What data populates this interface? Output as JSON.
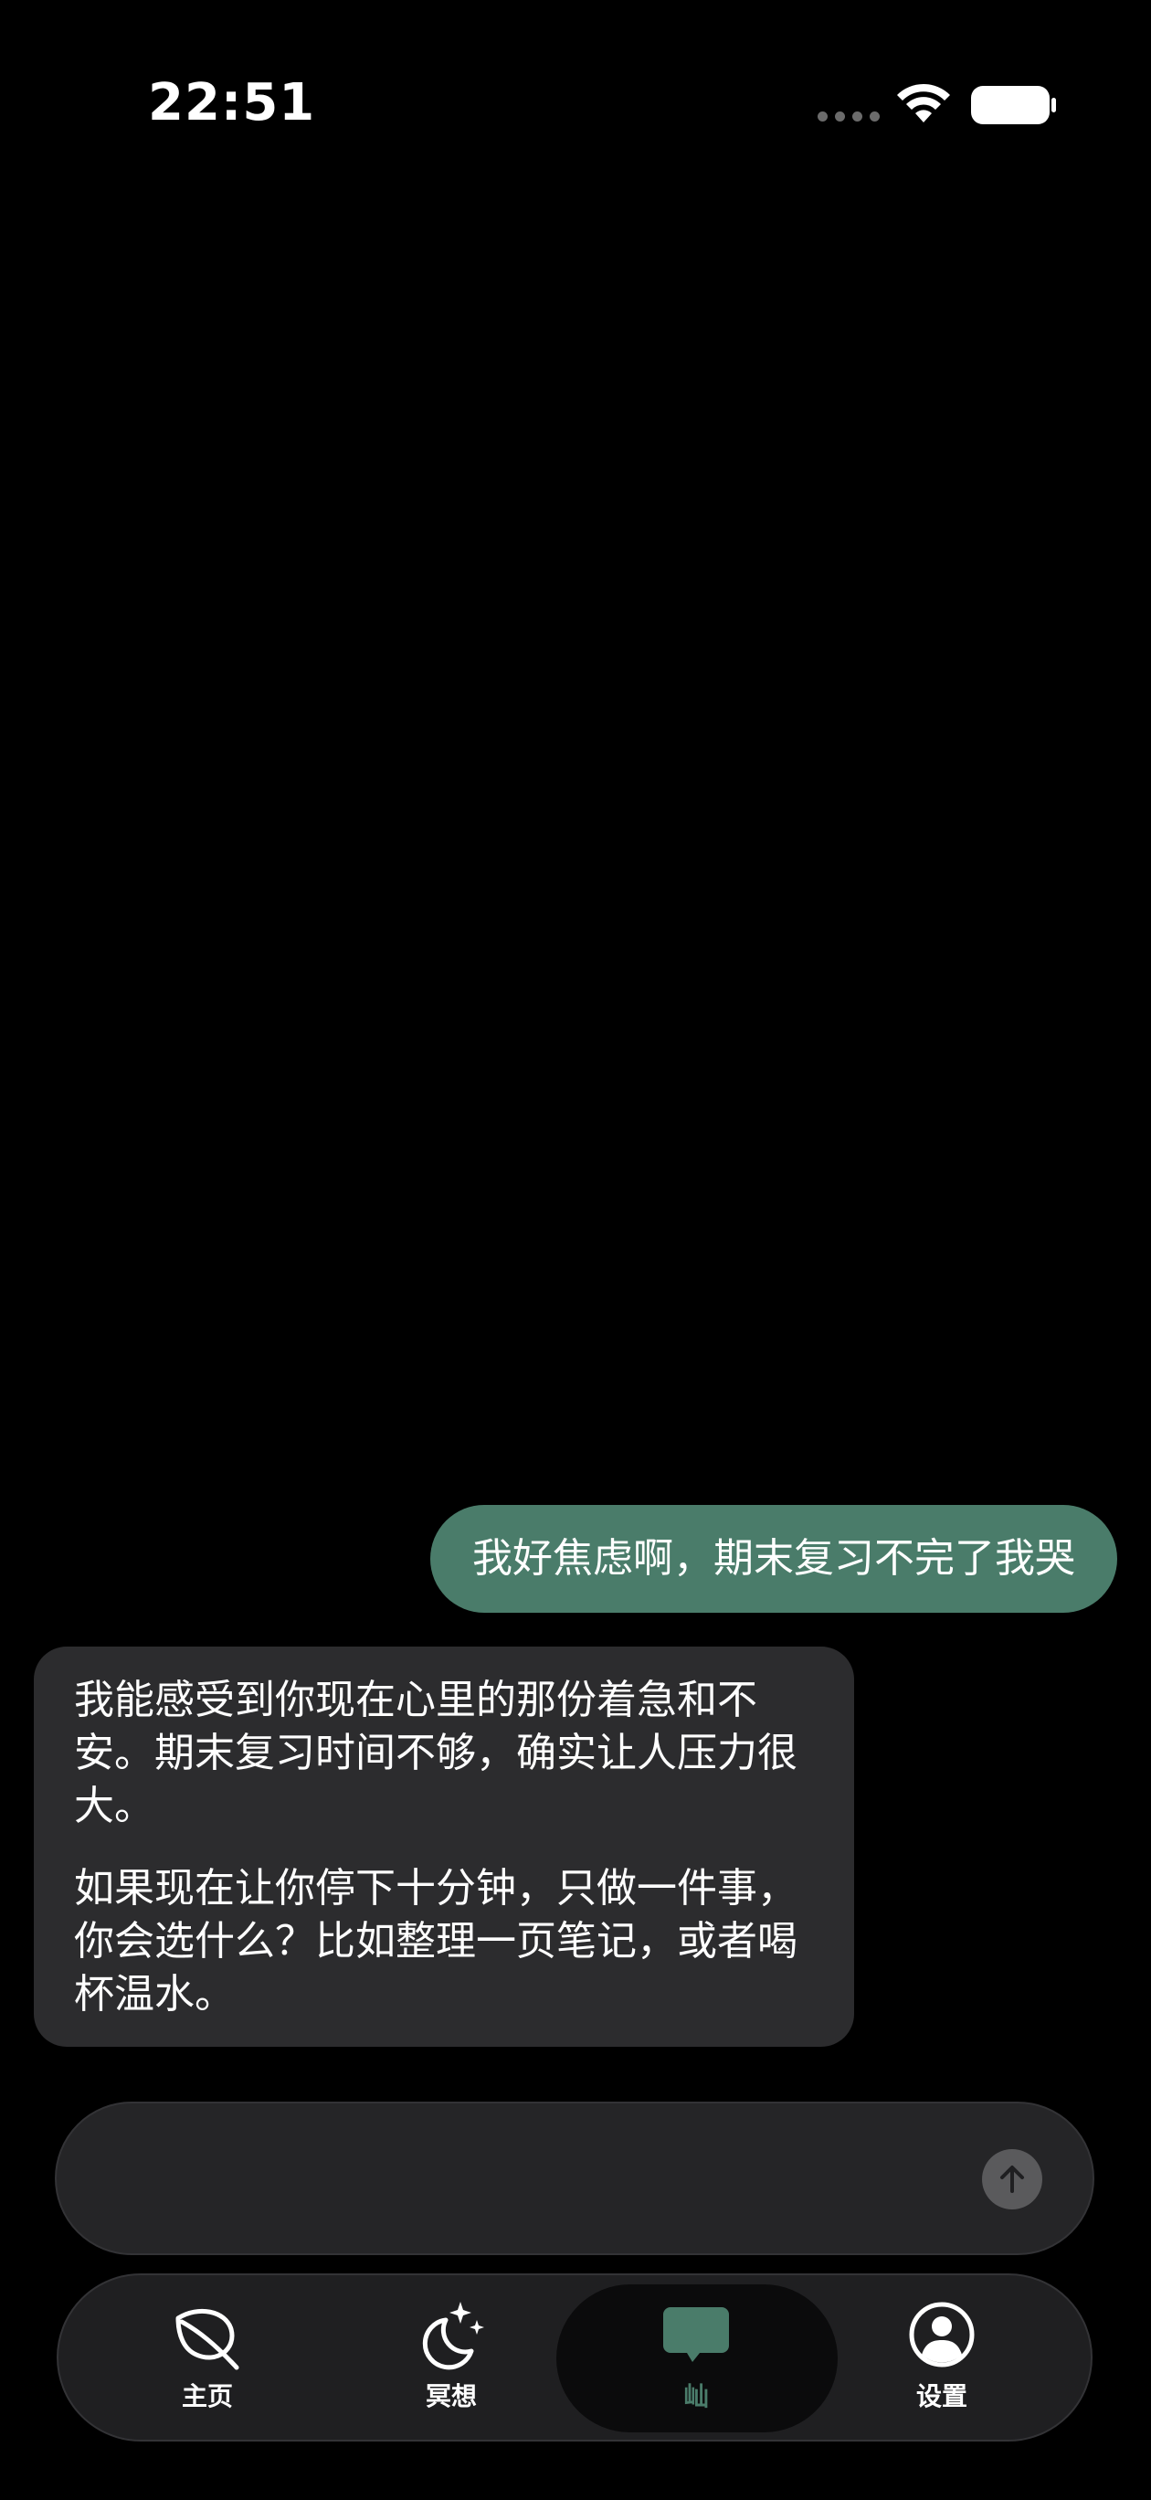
{
  "status_bar": {
    "time": "22:51",
    "icons": [
      "signal-dots-icon",
      "wifi-icon",
      "battery-icon"
    ]
  },
  "chat": {
    "messages": [
      {
        "role": "user",
        "text": "我好焦虑啊，期末复习不完了我哭"
      },
      {
        "role": "assistant",
        "paragraphs": [
          "我能感受到你现在心里的那份着急和不安。期末复习时间不够，确实让人压力很大。",
          "如果现在让你停下十分钟，只做一件事，你会选什么？比如整理一页笔记，或者喝杯温水。"
        ]
      }
    ]
  },
  "input": {
    "placeholder": "",
    "send_icon": "arrow-up-icon"
  },
  "tab_bar": {
    "tabs": [
      {
        "label": "主页",
        "icon": "leaf-icon",
        "active": false
      },
      {
        "label": "冥想",
        "icon": "moon-stars-icon",
        "active": false
      },
      {
        "label": "屾",
        "icon": "chat-bubble-icon",
        "active": true
      },
      {
        "label": "设置",
        "icon": "person-circle-icon",
        "active": false
      }
    ]
  },
  "colors": {
    "background": "#000000",
    "accent": "#4a7c6a",
    "ai_bubble": "#2c2c2e",
    "input_bg": "#252527",
    "tab_bar_bg": "#1f1f21"
  }
}
